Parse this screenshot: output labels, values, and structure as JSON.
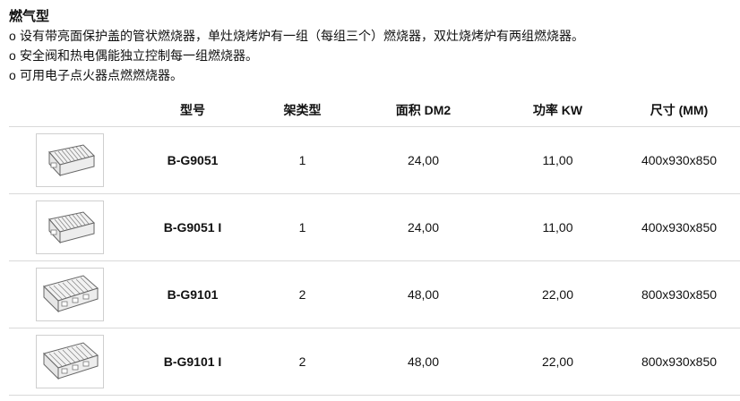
{
  "intro": {
    "title": "燃气型",
    "bullet_mark": "o",
    "bullets": [
      "设有带亮面保护盖的管状燃烧器，单灶烧烤炉有一组（每组三个）燃烧器，双灶烧烤炉有两组燃烧器。",
      "安全阀和热电偶能独立控制每一组燃烧器。",
      "可用电子点火器点燃燃烧器。"
    ]
  },
  "table": {
    "headers": {
      "model": "型号",
      "rack_type": "架类型",
      "area": "面积 DM2",
      "power": "功率 KW",
      "size": "尺寸 (MM)"
    },
    "rows": [
      {
        "image": "single-grill-icon",
        "model": "B-G9051",
        "rack_type": "1",
        "area": "24,00",
        "power": "11,00",
        "size": "400x930x850"
      },
      {
        "image": "single-grill-icon",
        "model": "B-G9051 I",
        "rack_type": "1",
        "area": "24,00",
        "power": "11,00",
        "size": "400x930x850"
      },
      {
        "image": "double-grill-icon",
        "model": "B-G9101",
        "rack_type": "2",
        "area": "48,00",
        "power": "22,00",
        "size": "800x930x850"
      },
      {
        "image": "double-grill-icon",
        "model": "B-G9101 I",
        "rack_type": "2",
        "area": "48,00",
        "power": "22,00",
        "size": "800x930x850"
      }
    ]
  }
}
